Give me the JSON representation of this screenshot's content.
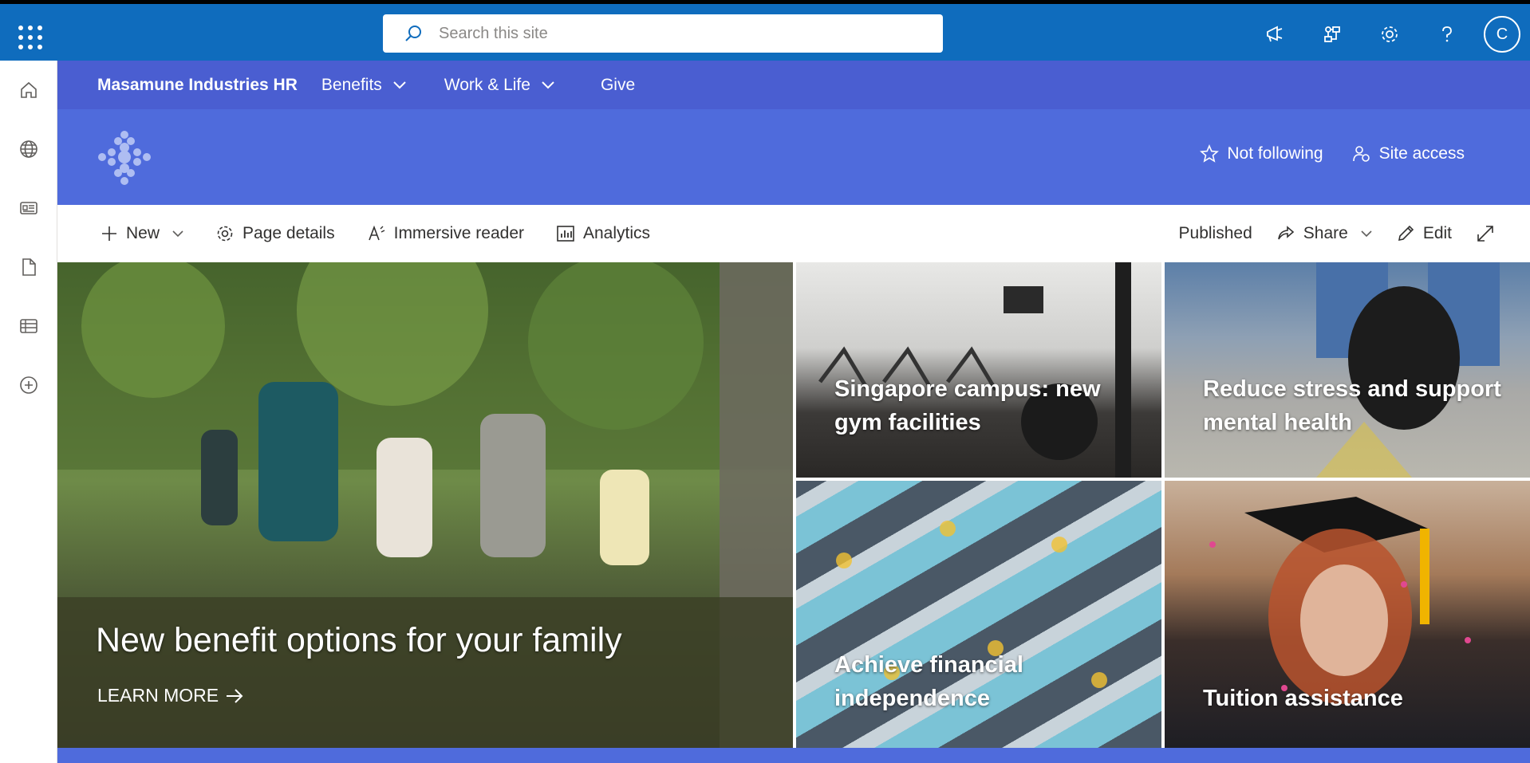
{
  "suite": {
    "search_placeholder": "Search this site",
    "avatar_initial": "C",
    "icons": [
      "megaphone-icon",
      "network-icon",
      "gear-icon",
      "help-icon"
    ]
  },
  "left_rail": [
    "home-icon",
    "globe-icon",
    "news-icon",
    "document-icon",
    "list-icon",
    "add-circle-icon"
  ],
  "hub_nav": {
    "title": "Masamune Industries HR",
    "items": [
      {
        "label": "Benefits",
        "has_dropdown": true
      },
      {
        "label": "Work & Life",
        "has_dropdown": true
      },
      {
        "label": "Give",
        "has_dropdown": false
      }
    ]
  },
  "site_header": {
    "follow_label": "Not following",
    "site_access_label": "Site access"
  },
  "command_bar": {
    "new_label": "New",
    "page_details_label": "Page details",
    "immersive_reader_label": "Immersive reader",
    "analytics_label": "Analytics",
    "published_label": "Published",
    "share_label": "Share",
    "edit_label": "Edit"
  },
  "hero": {
    "main": {
      "title": "New benefit options for your family",
      "link": "LEARN MORE"
    },
    "tiles": [
      {
        "title": "Singapore campus: new gym facilities"
      },
      {
        "title": "Reduce stress and support mental health"
      },
      {
        "title": "Achieve financial independence"
      },
      {
        "title": "Tuition assistance"
      }
    ]
  },
  "colors": {
    "suite_bar": "#0f6cbd",
    "hub_nav": "#4a5ed1",
    "site_header": "#4f6bdc"
  }
}
